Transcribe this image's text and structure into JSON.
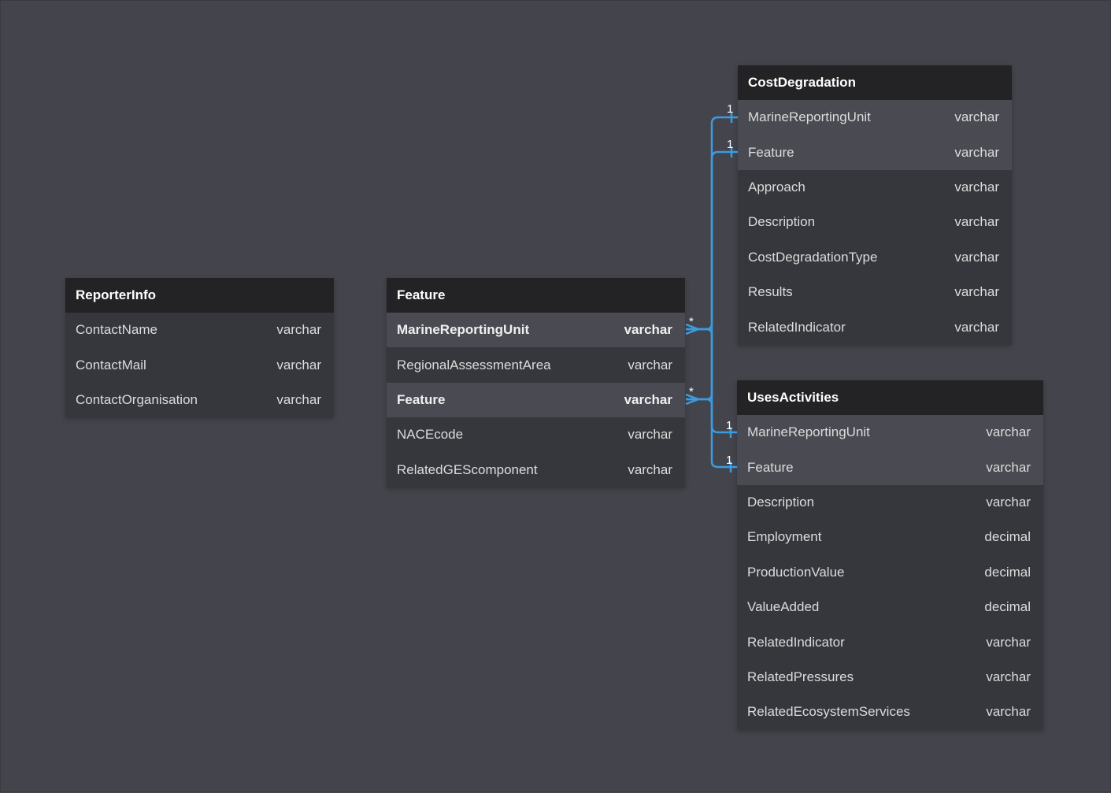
{
  "tables": {
    "reporter_info": {
      "name": "ReporterInfo",
      "columns": [
        {
          "name": "ContactName",
          "type": "varchar"
        },
        {
          "name": "ContactMail",
          "type": "varchar"
        },
        {
          "name": "ContactOrganisation",
          "type": "varchar"
        }
      ]
    },
    "feature": {
      "name": "Feature",
      "columns": [
        {
          "name": "MarineReportingUnit",
          "type": "varchar"
        },
        {
          "name": "RegionalAssessmentArea",
          "type": "varchar"
        },
        {
          "name": "Feature",
          "type": "varchar"
        },
        {
          "name": "NACEcode",
          "type": "varchar"
        },
        {
          "name": "RelatedGEScomponent",
          "type": "varchar"
        }
      ]
    },
    "cost_degradation": {
      "name": "CostDegradation",
      "columns": [
        {
          "name": "MarineReportingUnit",
          "type": "varchar"
        },
        {
          "name": "Feature",
          "type": "varchar"
        },
        {
          "name": "Approach",
          "type": "varchar"
        },
        {
          "name": "Description",
          "type": "varchar"
        },
        {
          "name": "CostDegradationType",
          "type": "varchar"
        },
        {
          "name": "Results",
          "type": "varchar"
        },
        {
          "name": "RelatedIndicator",
          "type": "varchar"
        }
      ]
    },
    "uses_activities": {
      "name": "UsesActivities",
      "columns": [
        {
          "name": "MarineReportingUnit",
          "type": "varchar"
        },
        {
          "name": "Feature",
          "type": "varchar"
        },
        {
          "name": "Description",
          "type": "varchar"
        },
        {
          "name": "Employment",
          "type": "decimal"
        },
        {
          "name": "ProductionValue",
          "type": "decimal"
        },
        {
          "name": "ValueAdded",
          "type": "decimal"
        },
        {
          "name": "RelatedIndicator",
          "type": "varchar"
        },
        {
          "name": "RelatedPressures",
          "type": "varchar"
        },
        {
          "name": "RelatedEcosystemServices",
          "type": "varchar"
        }
      ]
    }
  },
  "relations": {
    "many_label": "*",
    "one_label": "1"
  },
  "colors": {
    "background": "#44444c",
    "header": "#232325",
    "row": "#36363d",
    "row_highlight": "#4a4a52",
    "link": "#3d9be0"
  }
}
